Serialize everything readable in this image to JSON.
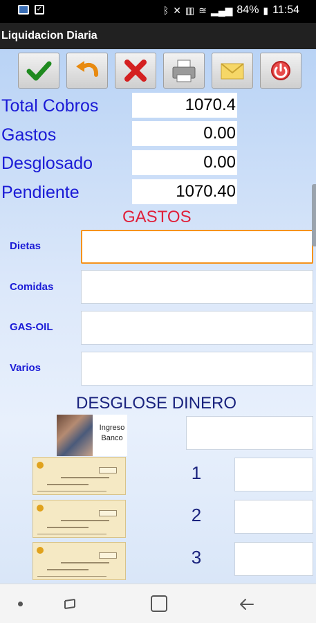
{
  "status_bar": {
    "battery": "84%",
    "time": "11:54"
  },
  "app": {
    "title": "Liquidacion Diaria"
  },
  "toolbar": {
    "buttons": [
      {
        "name": "confirm-button",
        "icon": "checkmark-icon"
      },
      {
        "name": "undo-button",
        "icon": "undo-icon"
      },
      {
        "name": "cancel-button",
        "icon": "close-icon"
      },
      {
        "name": "print-button",
        "icon": "printer-icon"
      },
      {
        "name": "email-button",
        "icon": "envelope-icon"
      },
      {
        "name": "power-button",
        "icon": "power-icon"
      }
    ]
  },
  "summary": {
    "total_cobros": {
      "label": "Total Cobros",
      "value": "1070.4"
    },
    "gastos": {
      "label": "Gastos",
      "value": "0.00"
    },
    "desglosado": {
      "label": "Desglosado",
      "value": "0.00"
    },
    "pendiente": {
      "label": "Pendiente",
      "value": "1070.40"
    }
  },
  "gastos_section": {
    "title": "GASTOS",
    "fields": [
      {
        "label": "Dietas",
        "value": ""
      },
      {
        "label": "Comidas",
        "value": ""
      },
      {
        "label": "GAS-OIL",
        "value": ""
      },
      {
        "label": "Varios",
        "value": ""
      }
    ]
  },
  "desglose_section": {
    "title": "DESGLOSE DINERO",
    "ingreso": {
      "label": "Ingreso Banco",
      "value": ""
    },
    "cheques": [
      {
        "number": "1",
        "value": ""
      },
      {
        "number": "2",
        "value": ""
      },
      {
        "number": "3",
        "value": ""
      }
    ]
  },
  "colors": {
    "label_blue": "#1a1ad6",
    "gastos_red": "#e0203a",
    "desglose_navy": "#1a237e",
    "focus_orange": "#f5931d"
  }
}
